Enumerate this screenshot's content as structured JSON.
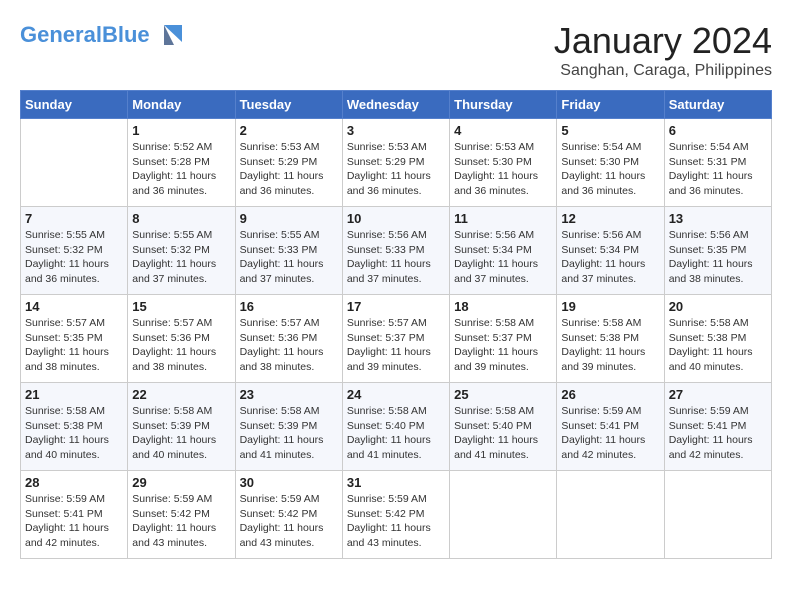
{
  "header": {
    "logo_line1": "General",
    "logo_line2": "Blue",
    "month_title": "January 2024",
    "subtitle": "Sanghan, Caraga, Philippines"
  },
  "days_of_week": [
    "Sunday",
    "Monday",
    "Tuesday",
    "Wednesday",
    "Thursday",
    "Friday",
    "Saturday"
  ],
  "weeks": [
    [
      {
        "day": "",
        "info": ""
      },
      {
        "day": "1",
        "info": "Sunrise: 5:52 AM\nSunset: 5:28 PM\nDaylight: 11 hours\nand 36 minutes."
      },
      {
        "day": "2",
        "info": "Sunrise: 5:53 AM\nSunset: 5:29 PM\nDaylight: 11 hours\nand 36 minutes."
      },
      {
        "day": "3",
        "info": "Sunrise: 5:53 AM\nSunset: 5:29 PM\nDaylight: 11 hours\nand 36 minutes."
      },
      {
        "day": "4",
        "info": "Sunrise: 5:53 AM\nSunset: 5:30 PM\nDaylight: 11 hours\nand 36 minutes."
      },
      {
        "day": "5",
        "info": "Sunrise: 5:54 AM\nSunset: 5:30 PM\nDaylight: 11 hours\nand 36 minutes."
      },
      {
        "day": "6",
        "info": "Sunrise: 5:54 AM\nSunset: 5:31 PM\nDaylight: 11 hours\nand 36 minutes."
      }
    ],
    [
      {
        "day": "7",
        "info": "Sunrise: 5:55 AM\nSunset: 5:32 PM\nDaylight: 11 hours\nand 36 minutes."
      },
      {
        "day": "8",
        "info": "Sunrise: 5:55 AM\nSunset: 5:32 PM\nDaylight: 11 hours\nand 37 minutes."
      },
      {
        "day": "9",
        "info": "Sunrise: 5:55 AM\nSunset: 5:33 PM\nDaylight: 11 hours\nand 37 minutes."
      },
      {
        "day": "10",
        "info": "Sunrise: 5:56 AM\nSunset: 5:33 PM\nDaylight: 11 hours\nand 37 minutes."
      },
      {
        "day": "11",
        "info": "Sunrise: 5:56 AM\nSunset: 5:34 PM\nDaylight: 11 hours\nand 37 minutes."
      },
      {
        "day": "12",
        "info": "Sunrise: 5:56 AM\nSunset: 5:34 PM\nDaylight: 11 hours\nand 37 minutes."
      },
      {
        "day": "13",
        "info": "Sunrise: 5:56 AM\nSunset: 5:35 PM\nDaylight: 11 hours\nand 38 minutes."
      }
    ],
    [
      {
        "day": "14",
        "info": "Sunrise: 5:57 AM\nSunset: 5:35 PM\nDaylight: 11 hours\nand 38 minutes."
      },
      {
        "day": "15",
        "info": "Sunrise: 5:57 AM\nSunset: 5:36 PM\nDaylight: 11 hours\nand 38 minutes."
      },
      {
        "day": "16",
        "info": "Sunrise: 5:57 AM\nSunset: 5:36 PM\nDaylight: 11 hours\nand 38 minutes."
      },
      {
        "day": "17",
        "info": "Sunrise: 5:57 AM\nSunset: 5:37 PM\nDaylight: 11 hours\nand 39 minutes."
      },
      {
        "day": "18",
        "info": "Sunrise: 5:58 AM\nSunset: 5:37 PM\nDaylight: 11 hours\nand 39 minutes."
      },
      {
        "day": "19",
        "info": "Sunrise: 5:58 AM\nSunset: 5:38 PM\nDaylight: 11 hours\nand 39 minutes."
      },
      {
        "day": "20",
        "info": "Sunrise: 5:58 AM\nSunset: 5:38 PM\nDaylight: 11 hours\nand 40 minutes."
      }
    ],
    [
      {
        "day": "21",
        "info": "Sunrise: 5:58 AM\nSunset: 5:38 PM\nDaylight: 11 hours\nand 40 minutes."
      },
      {
        "day": "22",
        "info": "Sunrise: 5:58 AM\nSunset: 5:39 PM\nDaylight: 11 hours\nand 40 minutes."
      },
      {
        "day": "23",
        "info": "Sunrise: 5:58 AM\nSunset: 5:39 PM\nDaylight: 11 hours\nand 41 minutes."
      },
      {
        "day": "24",
        "info": "Sunrise: 5:58 AM\nSunset: 5:40 PM\nDaylight: 11 hours\nand 41 minutes."
      },
      {
        "day": "25",
        "info": "Sunrise: 5:58 AM\nSunset: 5:40 PM\nDaylight: 11 hours\nand 41 minutes."
      },
      {
        "day": "26",
        "info": "Sunrise: 5:59 AM\nSunset: 5:41 PM\nDaylight: 11 hours\nand 42 minutes."
      },
      {
        "day": "27",
        "info": "Sunrise: 5:59 AM\nSunset: 5:41 PM\nDaylight: 11 hours\nand 42 minutes."
      }
    ],
    [
      {
        "day": "28",
        "info": "Sunrise: 5:59 AM\nSunset: 5:41 PM\nDaylight: 11 hours\nand 42 minutes."
      },
      {
        "day": "29",
        "info": "Sunrise: 5:59 AM\nSunset: 5:42 PM\nDaylight: 11 hours\nand 43 minutes."
      },
      {
        "day": "30",
        "info": "Sunrise: 5:59 AM\nSunset: 5:42 PM\nDaylight: 11 hours\nand 43 minutes."
      },
      {
        "day": "31",
        "info": "Sunrise: 5:59 AM\nSunset: 5:42 PM\nDaylight: 11 hours\nand 43 minutes."
      },
      {
        "day": "",
        "info": ""
      },
      {
        "day": "",
        "info": ""
      },
      {
        "day": "",
        "info": ""
      }
    ]
  ]
}
